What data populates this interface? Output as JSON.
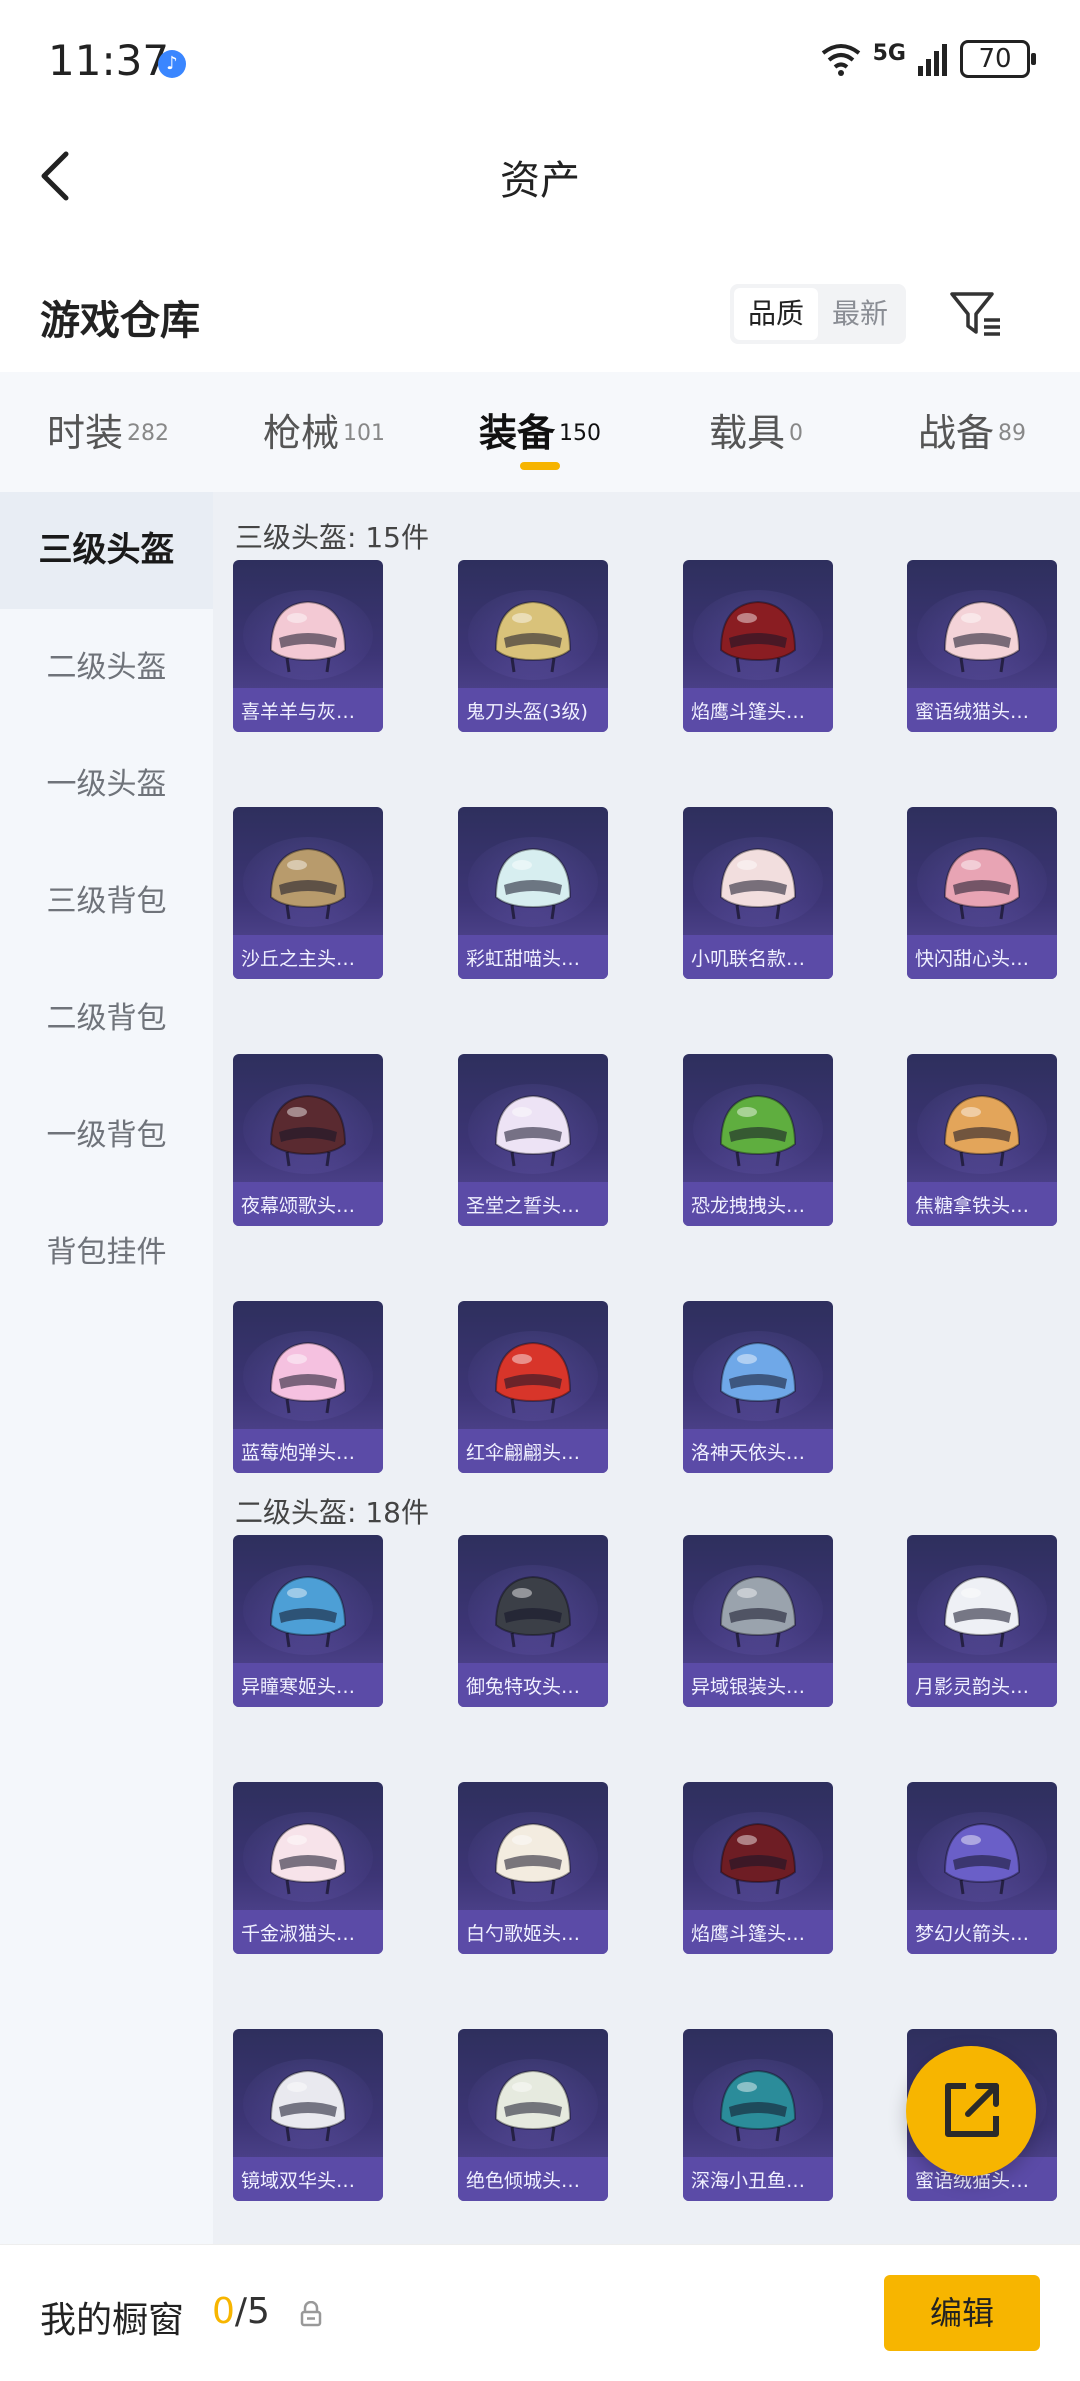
{
  "status_bar": {
    "time": "11:37",
    "network": "5G",
    "battery": "70"
  },
  "header": {
    "title": "资产"
  },
  "warehouse": {
    "title": "游戏仓库",
    "sort_options": [
      "品质",
      "最新"
    ],
    "active_sort": "品质"
  },
  "tabs": [
    {
      "label": "时装",
      "count": "282"
    },
    {
      "label": "枪械",
      "count": "101"
    },
    {
      "label": "装备",
      "count": "150"
    },
    {
      "label": "载具",
      "count": "0"
    },
    {
      "label": "战备",
      "count": "89"
    }
  ],
  "active_tab": "装备",
  "sidebar": {
    "items": [
      "三级头盔",
      "二级头盔",
      "一级头盔",
      "三级背包",
      "二级背包",
      "一级背包",
      "背包挂件"
    ],
    "active": "三级头盔"
  },
  "sections": [
    {
      "title": "三级头盔: 15件",
      "items": [
        {
          "name": "喜羊羊与灰…",
          "color": "#f3c9d4"
        },
        {
          "name": "鬼刀头盔(3级)",
          "color": "#d9c27a"
        },
        {
          "name": "焰鹰斗篷头…",
          "color": "#8a1d22"
        },
        {
          "name": "蜜语绒猫头…",
          "color": "#f4d3d8"
        },
        {
          "name": "沙丘之主头…",
          "color": "#b89b6c"
        },
        {
          "name": "彩虹甜喵头…",
          "color": "#d7eef0"
        },
        {
          "name": "小叽联名款…",
          "color": "#f2dede"
        },
        {
          "name": "快闪甜心头…",
          "color": "#e8a4b4"
        },
        {
          "name": "夜幕颂歌头…",
          "color": "#5a2a30"
        },
        {
          "name": "圣堂之誓头…",
          "color": "#ede3f5"
        },
        {
          "name": "恐龙拽拽头…",
          "color": "#5fae3f"
        },
        {
          "name": "焦糖拿铁头…",
          "color": "#e3a55a"
        },
        {
          "name": "蓝莓炮弹头…",
          "color": "#f5c1e0"
        },
        {
          "name": "红伞翩翩头…",
          "color": "#d8352a"
        },
        {
          "name": "洛神天依头…",
          "color": "#6fa8e8"
        }
      ]
    },
    {
      "title": "二级头盔: 18件",
      "items": [
        {
          "name": "异瞳寒姬头…",
          "color": "#4d9fd6"
        },
        {
          "name": "御兔特攻头…",
          "color": "#3b3f47"
        },
        {
          "name": "异域银装头…",
          "color": "#9aa3ad"
        },
        {
          "name": "月影灵韵头…",
          "color": "#eef0f5"
        },
        {
          "name": "千金淑猫头…",
          "color": "#f7e3ea"
        },
        {
          "name": "白勺歌姬头…",
          "color": "#f3ece0"
        },
        {
          "name": "焰鹰斗篷头…",
          "color": "#6e1d24"
        },
        {
          "name": "梦幻火箭头…",
          "color": "#6a5fc8"
        },
        {
          "name": "镜域双华头…",
          "color": "#e9e9ef"
        },
        {
          "name": "绝色倾城头…",
          "color": "#e6eadf"
        },
        {
          "name": "深海小丑鱼…",
          "color": "#2b8c9a"
        },
        {
          "name": "蜜语绒猫头…",
          "color": "#f2d6dc"
        }
      ]
    }
  ],
  "bottom_bar": {
    "label": "我的橱窗",
    "current": "0",
    "total": "/5",
    "edit_label": "编辑"
  },
  "colors": {
    "accent": "#f7b500",
    "card_bg": "#3d3576",
    "card_band": "#5b4ba7"
  },
  "icons": [
    "back-icon",
    "filter-icon",
    "share-icon",
    "lock-icon",
    "wifi-icon",
    "signal-icon",
    "music-icon"
  ]
}
